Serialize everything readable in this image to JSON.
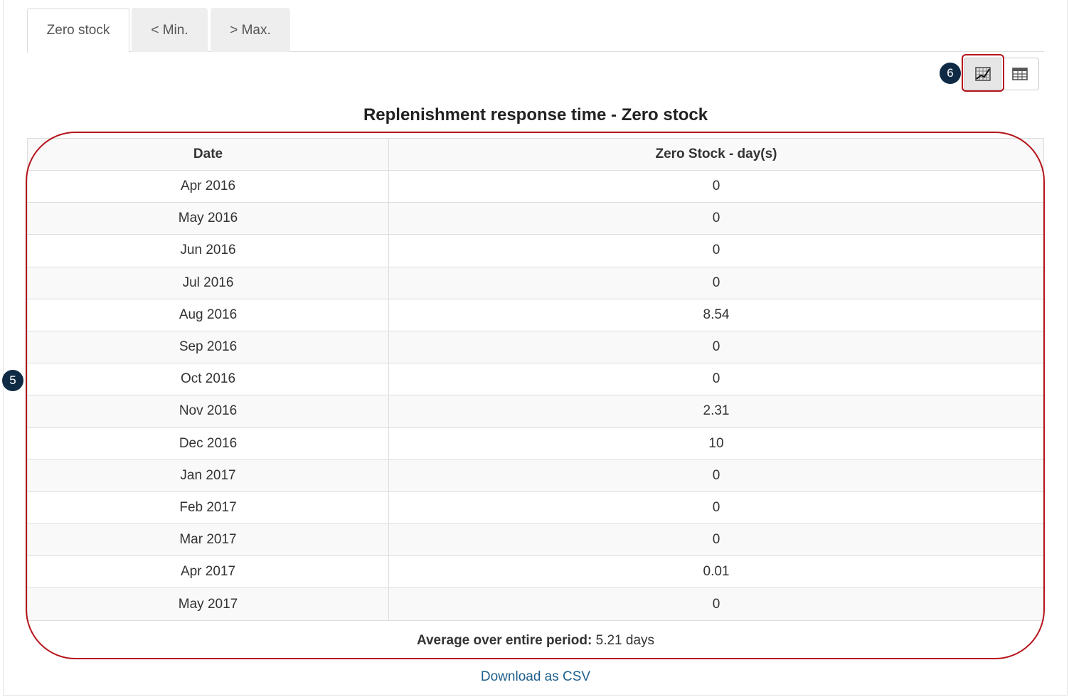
{
  "tabs": [
    {
      "label": "Zero stock",
      "active": true
    },
    {
      "label": "< Min.",
      "active": false
    },
    {
      "label": "> Max.",
      "active": false
    }
  ],
  "view_toggle": {
    "chart_icon": "chart-icon",
    "table_icon": "table-icon",
    "selected": "chart"
  },
  "annotations": {
    "badge_5": "5",
    "badge_6": "6",
    "highlight_color": "#b5141b"
  },
  "title": "Replenishment response time - Zero stock",
  "table": {
    "headers": [
      "Date",
      "Zero Stock - day(s)"
    ],
    "rows": [
      [
        "Apr 2016",
        "0"
      ],
      [
        "May 2016",
        "0"
      ],
      [
        "Jun 2016",
        "0"
      ],
      [
        "Jul 2016",
        "0"
      ],
      [
        "Aug 2016",
        "8.54"
      ],
      [
        "Sep 2016",
        "0"
      ],
      [
        "Oct 2016",
        "0"
      ],
      [
        "Nov 2016",
        "2.31"
      ],
      [
        "Dec 2016",
        "10"
      ],
      [
        "Jan 2017",
        "0"
      ],
      [
        "Feb 2017",
        "0"
      ],
      [
        "Mar 2017",
        "0"
      ],
      [
        "Apr 2017",
        "0.01"
      ],
      [
        "May 2017",
        "0"
      ]
    ]
  },
  "average": {
    "label": "Average over entire period:",
    "value": "5.21 days"
  },
  "download_link": "Download as CSV"
}
